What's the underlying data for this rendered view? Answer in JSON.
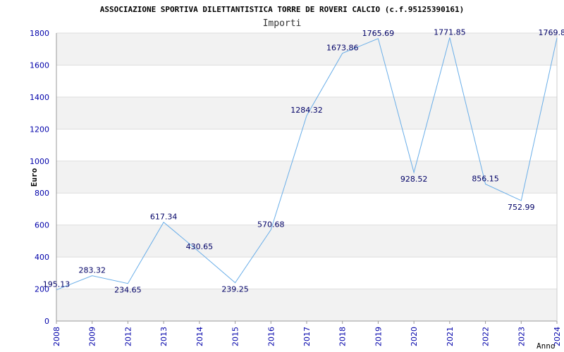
{
  "chart_data": {
    "type": "line",
    "title": "ASSOCIAZIONE SPORTIVA DILETTANTISTICA TORRE DE ROVERI CALCIO (c.f.95125390161)",
    "subtitle": "Importi",
    "xlabel": "Anno",
    "ylabel": "Euro",
    "ylim": [
      0,
      1800
    ],
    "yticks": [
      0,
      200,
      400,
      600,
      800,
      1000,
      1200,
      1400,
      1600,
      1800
    ],
    "grid": true,
    "categories": [
      "2008",
      "2009",
      "2012",
      "2013",
      "2014",
      "2015",
      "2016",
      "2017",
      "2018",
      "2019",
      "2020",
      "2021",
      "2022",
      "2023",
      "2024"
    ],
    "values": [
      195.13,
      283.32,
      234.65,
      617.34,
      430.65,
      239.25,
      570.68,
      1284.32,
      1673.86,
      1765.69,
      928.52,
      1771.85,
      856.15,
      752.99,
      1769.8
    ],
    "data_labels": [
      "195.13",
      "283.32",
      "234.65",
      "617.34",
      "430.65",
      "239.25",
      "570.68",
      "1284.32",
      "1673.86",
      "1765.69",
      "928.52",
      "1771.85",
      "856.15",
      "752.99",
      "1769.8"
    ],
    "colors": {
      "line": "#6aaee8",
      "axis_text": "#0000aa",
      "label_text": "#000066",
      "title_text": "#000000",
      "band": "#f2f2f2",
      "grid": "#dddddd"
    }
  }
}
